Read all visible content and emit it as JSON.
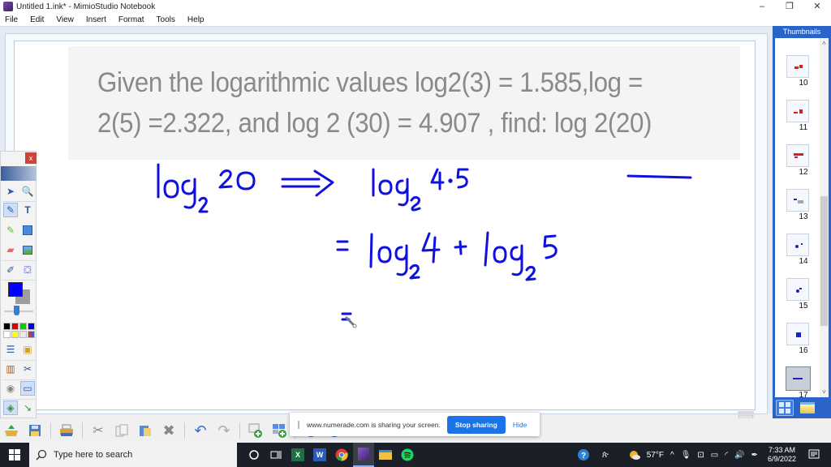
{
  "window": {
    "title": "Untitled 1.ink* - MimioStudio Notebook",
    "controls": {
      "minimize": "–",
      "maximize": "❐",
      "close": "✕"
    }
  },
  "menu": [
    {
      "label": "File",
      "mnemonic": "F"
    },
    {
      "label": "Edit",
      "mnemonic": "E"
    },
    {
      "label": "View",
      "mnemonic": "V"
    },
    {
      "label": "Insert",
      "mnemonic": "I"
    },
    {
      "label": "Format",
      "mnemonic": "o"
    },
    {
      "label": "Tools",
      "mnemonic": "T"
    },
    {
      "label": "Help",
      "mnemonic": "H"
    }
  ],
  "canvas": {
    "question_line1": "Given the logarithmic values log2(3) = 1.585,log =",
    "question_line2": "2(5) =2.322, and log 2 (30) = 4.907 , find: log 2(20)",
    "ink_color": "#1010e0",
    "handwriting": [
      "log₂ 20 ⟹ log₂ 4·5",
      "= log₂ 4 + log₂ 5",
      "="
    ]
  },
  "thumbnails": {
    "header": "Thumbnails",
    "pages": [
      {
        "number": "10",
        "color": "#d02020",
        "selected": false
      },
      {
        "number": "11",
        "color": "#d02020",
        "selected": false
      },
      {
        "number": "12",
        "color": "#d02020",
        "selected": false
      },
      {
        "number": "13",
        "color": "#2020c0",
        "selected": false
      },
      {
        "number": "14",
        "color": "#2020c0",
        "selected": false
      },
      {
        "number": "15",
        "color": "#2020c0",
        "selected": false
      },
      {
        "number": "16",
        "color": "#2020c0",
        "selected": false
      },
      {
        "number": "17",
        "color": "#2020c0",
        "selected": true
      }
    ],
    "scroll_up": "˄",
    "scroll_down": "˅"
  },
  "toolbox": {
    "close": "x",
    "current_color": "#0000ff",
    "palette": [
      "#000000",
      "#e00000",
      "#00d000",
      "#0000e0",
      "#ffffff",
      "#ffff00",
      "#e8e8e8",
      "multi"
    ]
  },
  "share_bar": {
    "message": "www.numerade.com is sharing your screen.",
    "stop_label": "Stop sharing",
    "hide_label": "Hide"
  },
  "taskbar": {
    "search_placeholder": "Type here to search",
    "weather": "57°F",
    "time": "7:33 AM",
    "date": "6/9/2022"
  }
}
